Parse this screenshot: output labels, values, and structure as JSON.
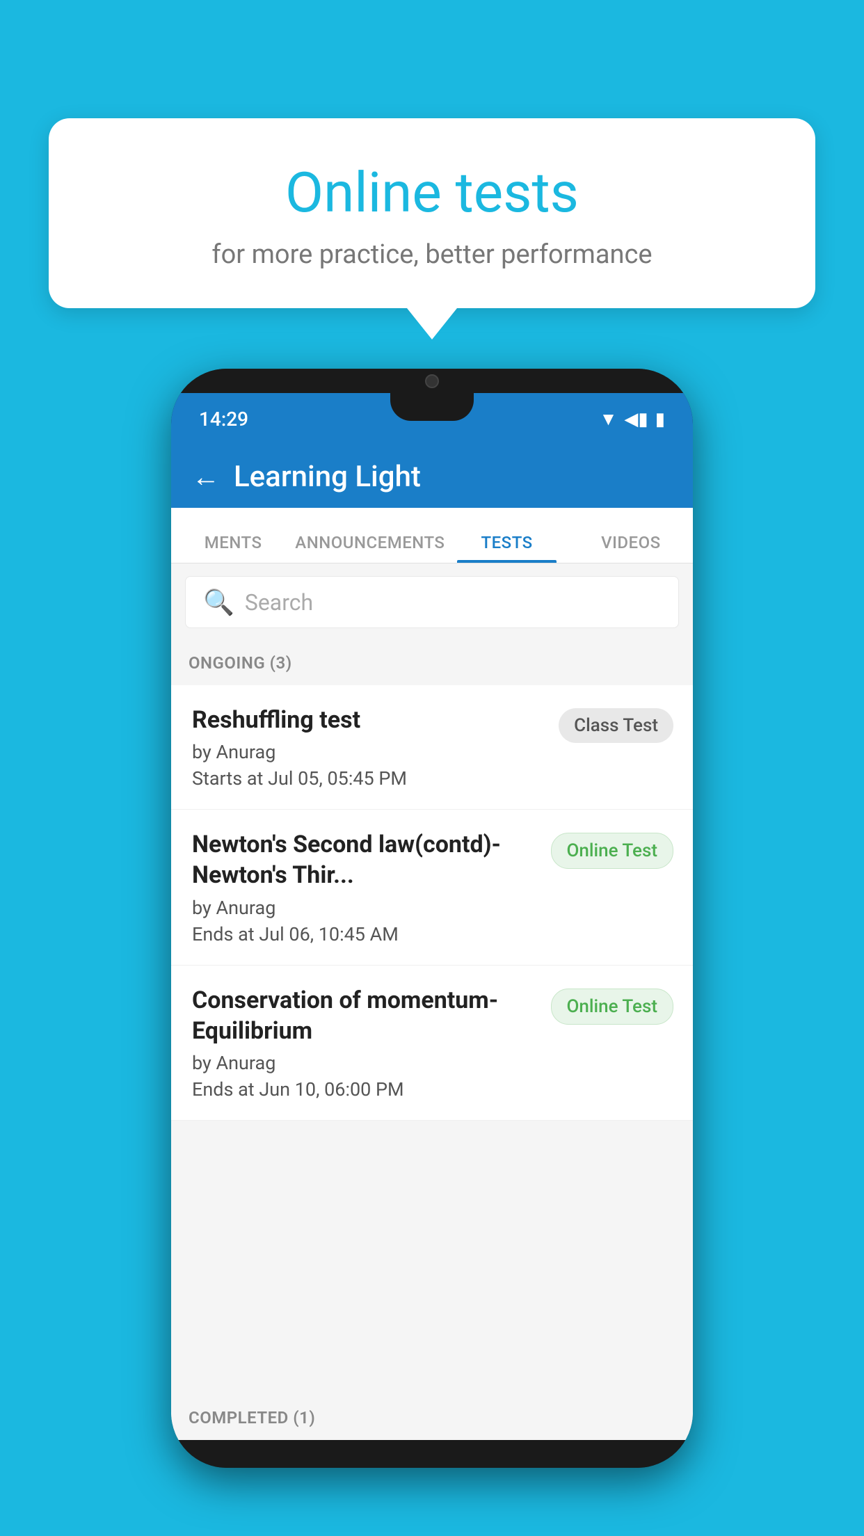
{
  "background": {
    "color": "#1BB8E0"
  },
  "bubble": {
    "title": "Online tests",
    "subtitle": "for more practice, better performance"
  },
  "phone": {
    "status": {
      "time": "14:29"
    },
    "header": {
      "title": "Learning Light",
      "back_label": "←"
    },
    "tabs": [
      {
        "label": "MENTS",
        "active": false
      },
      {
        "label": "ANNOUNCEMENTS",
        "active": false
      },
      {
        "label": "TESTS",
        "active": true
      },
      {
        "label": "VIDEOS",
        "active": false
      }
    ],
    "search": {
      "placeholder": "Search"
    },
    "ongoing_section": {
      "label": "ONGOING (3)"
    },
    "tests": [
      {
        "name": "Reshuffling test",
        "author": "by Anurag",
        "date_label": "Starts at",
        "date": "Jul 05, 05:45 PM",
        "badge": "Class Test",
        "badge_type": "class"
      },
      {
        "name": "Newton's Second law(contd)-Newton's Thir...",
        "author": "by Anurag",
        "date_label": "Ends at",
        "date": "Jul 06, 10:45 AM",
        "badge": "Online Test",
        "badge_type": "online"
      },
      {
        "name": "Conservation of momentum-Equilibrium",
        "author": "by Anurag",
        "date_label": "Ends at",
        "date": "Jun 10, 06:00 PM",
        "badge": "Online Test",
        "badge_type": "online"
      }
    ],
    "completed_section": {
      "label": "COMPLETED (1)"
    }
  }
}
